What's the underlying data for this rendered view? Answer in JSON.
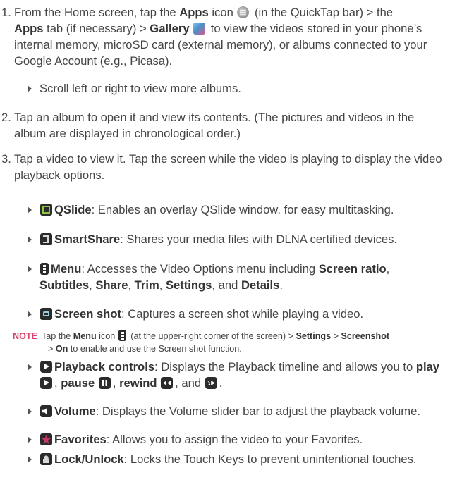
{
  "step1": {
    "num": "1.",
    "t1": "From the Home screen, tap the ",
    "apps": "Apps",
    "t2": " icon ",
    "t3": " (in the QuickTap bar) > the",
    "apps_tab": "Apps",
    "t4": " tab (if necessary) > ",
    "gallery": "Gallery",
    "t5": " to view the videos stored in your phone’s internal memory, microSD card (external memory), or albums connected to your Google Account (e.g., Picasa).",
    "icons": [
      "apps-icon",
      "gallery-icon"
    ]
  },
  "bullet0": "Scroll left or right to view more albums.",
  "step2": {
    "num": "2.",
    "text": "Tap an album to open it and view its contents. (The pictures and videos in the album are displayed in chronological order.)"
  },
  "step3": {
    "num": "3.",
    "text": "Tap a video to view it. Tap the screen while the video is playing to display the video playback options."
  },
  "options": {
    "qslide": {
      "label": "QSlide",
      "desc": ": Enables an overlay QSlide window. for easy multitasking."
    },
    "smartshare": {
      "label": "SmartShare",
      "desc": ": Shares your media files with DLNA certified devices."
    },
    "menu": {
      "label": "Menu",
      "d1": ": Accesses the Video Options menu including ",
      "screen_ratio": "Screen ratio",
      "sep1": ",",
      "subtitles": "Subtitles",
      "sep2": ", ",
      "share": "Share",
      "sep3": ", ",
      "trim": "Trim",
      "sep4": ", ",
      "settings": "Settings",
      "sep5": ", and ",
      "details": "Details",
      "end": "."
    },
    "screenshot": {
      "label": "Screen shot",
      "desc": ": Captures a screen shot while playing a video."
    },
    "playback": {
      "label": "Playback controls",
      "d1": ": Displays the Playback timeline and allows you to ",
      "play": "play",
      "sep1": ", ",
      "pause": "pause",
      "sep2": ", ",
      "rewind": "rewind",
      "sep3": ", and ",
      "end": "."
    },
    "volume": {
      "label": "Volume",
      "desc": ": Displays the Volume slider bar to adjust the playback volume."
    },
    "favorites": {
      "label": "Favorites",
      "desc": ": Allows you to assign the video to your Favorites."
    },
    "lock": {
      "label": "Lock/Unlock",
      "desc": ": Locks the Touch Keys to prevent unintentional touches."
    }
  },
  "note": {
    "label": "NOTE",
    "t1": "Tap the ",
    "menu": "Menu",
    "t2": " icon ",
    "t3": " (at the upper-right corner of the screen) > ",
    "settings": "Settings",
    "t4": " > ",
    "screenshot": "Screenshot",
    "t5": " > ",
    "on": "On",
    "t6": " to enable and use the Screen shot function."
  }
}
